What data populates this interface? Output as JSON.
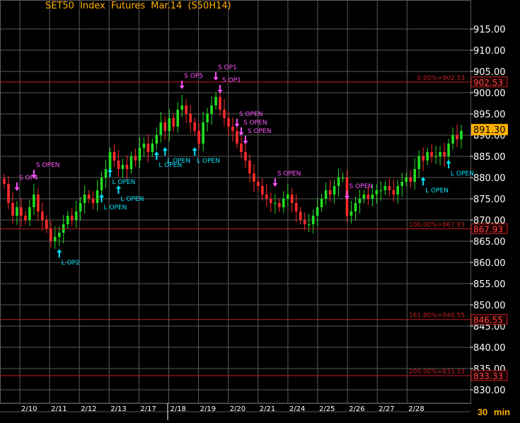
{
  "title": "SET50  Index  Futures  Mar.14  (S50H14)",
  "interval_label": "30  min",
  "colors": {
    "background": "#000000",
    "grid": "#5a5a5a",
    "up": "#22dd22",
    "down": "#ff2b2b",
    "fib_line": "#c02020",
    "long_marker": "#00e5ff",
    "short_marker": "#ff55ff",
    "last_price_bg": "#ffb000",
    "axis_text": "#ffffff",
    "title": "#ffb000"
  },
  "chart_data": {
    "type": "candlestick",
    "title": "SET50  Index  Futures  Mar.14  (S50H14)",
    "interval": "30  min",
    "x_categories": [
      "2/10",
      "2/11",
      "2/12",
      "2/13",
      "2/17",
      "2/18",
      "2/19",
      "2/20",
      "2/21",
      "2/24",
      "2/25",
      "2/26",
      "2/27",
      "2/28"
    ],
    "y_range": [
      825,
      918
    ],
    "y_ticks": [
      "915.00",
      "910.00",
      "905.00",
      "900.00",
      "895.00",
      "890.00",
      "885.00",
      "880.00",
      "875.00",
      "870.00",
      "865.00",
      "860.00",
      "855.00",
      "850.00",
      "845.00",
      "840.00",
      "835.00",
      "830.00"
    ],
    "grid": true,
    "series_close": [
      878.5,
      874,
      871,
      873,
      871,
      870,
      873,
      876,
      872,
      870,
      868,
      865,
      866,
      867,
      869,
      871,
      870,
      872,
      874,
      876,
      875,
      874,
      877,
      880,
      882,
      886,
      884,
      882,
      883,
      882,
      885,
      884,
      887,
      888,
      886,
      888,
      890,
      893,
      891,
      894,
      892,
      896,
      897,
      895,
      893,
      891,
      888,
      893,
      895,
      897,
      899,
      896,
      894,
      892,
      891,
      888,
      886,
      884,
      881,
      879,
      878,
      876,
      875,
      874,
      874,
      873,
      875,
      876,
      874,
      872,
      870,
      869,
      869,
      871,
      873,
      875,
      877,
      876,
      878,
      880,
      880,
      871,
      872,
      874,
      875,
      876,
      875,
      876,
      877,
      877,
      878,
      877,
      876,
      878,
      879,
      880,
      879,
      882,
      885,
      884,
      886,
      885,
      885,
      886,
      885,
      888,
      890,
      889,
      891
    ],
    "levels": [
      {
        "label": "0.00%=902.53",
        "value": 902.53,
        "tag": "902.53"
      },
      {
        "label": "100.00%=867.93",
        "value": 867.93,
        "tag": "867.93"
      },
      {
        "label": "161.80%=846.55",
        "value": 846.55,
        "tag": "846.55"
      },
      {
        "label": "200.00%=833.33",
        "value": 833.33,
        "tag": "833.33"
      }
    ],
    "last_price": {
      "value": 891.3,
      "tag": "891.30"
    },
    "signals": [
      {
        "side": "short",
        "label": "S  OP4",
        "index": 3
      },
      {
        "side": "short",
        "label": "S  OPEN",
        "index": 7
      },
      {
        "side": "long",
        "label": "L  OP2",
        "index": 13
      },
      {
        "side": "long",
        "label": "L  OPEN",
        "index": 23
      },
      {
        "side": "long",
        "label": "L  OPEN",
        "index": 25
      },
      {
        "side": "long",
        "label": "L  OPEN",
        "index": 27
      },
      {
        "side": "long",
        "label": "L  OPEN",
        "index": 36
      },
      {
        "side": "long",
        "label": "L  OPEN",
        "index": 38
      },
      {
        "side": "short",
        "label": "S  OP5",
        "index": 42
      },
      {
        "side": "long",
        "label": "L  OPEN",
        "index": 45
      },
      {
        "side": "short",
        "label": "S  OP1",
        "index": 50
      },
      {
        "side": "short",
        "label": "S  OP1",
        "index": 51
      },
      {
        "side": "short",
        "label": "S  OPEN",
        "index": 55
      },
      {
        "side": "short",
        "label": "S  OPEN",
        "index": 56
      },
      {
        "side": "short",
        "label": "S  OPEN",
        "index": 57
      },
      {
        "side": "short",
        "label": "S  OPEN",
        "index": 64
      },
      {
        "side": "short",
        "label": "S  OPEN",
        "index": 81
      },
      {
        "side": "long",
        "label": "L  OPEN",
        "index": 99
      },
      {
        "side": "long",
        "label": "L  OPEN",
        "index": 105
      }
    ]
  }
}
